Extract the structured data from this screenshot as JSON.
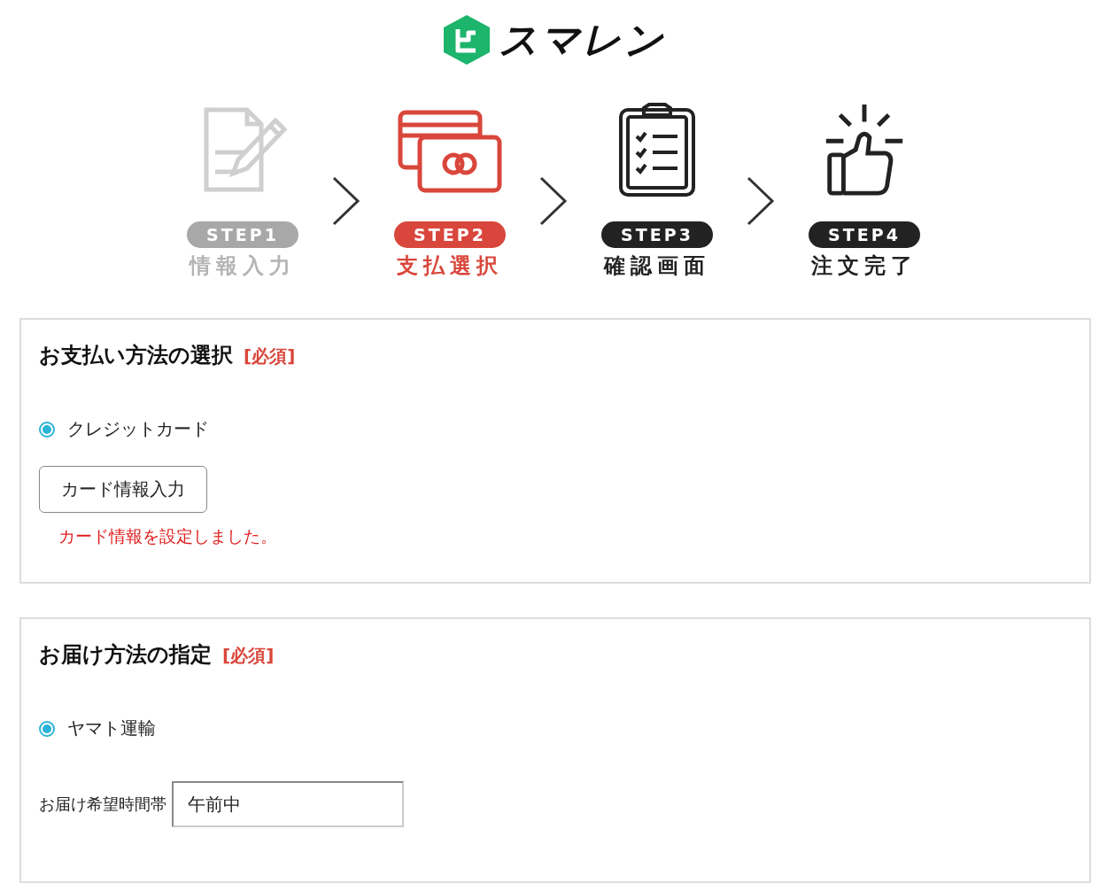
{
  "logo": {
    "text": "スマレン"
  },
  "steps": [
    {
      "label": "STEP1",
      "name": "情報入力",
      "completed": true,
      "selected": false,
      "kind": "form"
    },
    {
      "label": "STEP2",
      "name": "支払選択",
      "completed": false,
      "selected": true,
      "kind": "cards"
    },
    {
      "label": "STEP3",
      "name": "確認画面",
      "completed": false,
      "selected": false,
      "kind": "clipboard"
    },
    {
      "label": "STEP4",
      "name": "注文完了",
      "completed": false,
      "selected": false,
      "kind": "thumb"
    }
  ],
  "sections": [
    {
      "title": "お支払い方法の選択",
      "required": "[必須]",
      "options": [
        {
          "label": "クレジットカード",
          "selected": true
        }
      ],
      "button": "カード情報入力",
      "message": "カード情報を設定しました。"
    },
    {
      "title": "お届け方法の指定",
      "required": "[必須]",
      "options": [
        {
          "label": "ヤマト運輸",
          "selected": true
        }
      ],
      "field": {
        "label": "お届け希望時間帯",
        "value": "午前中"
      }
    }
  ]
}
